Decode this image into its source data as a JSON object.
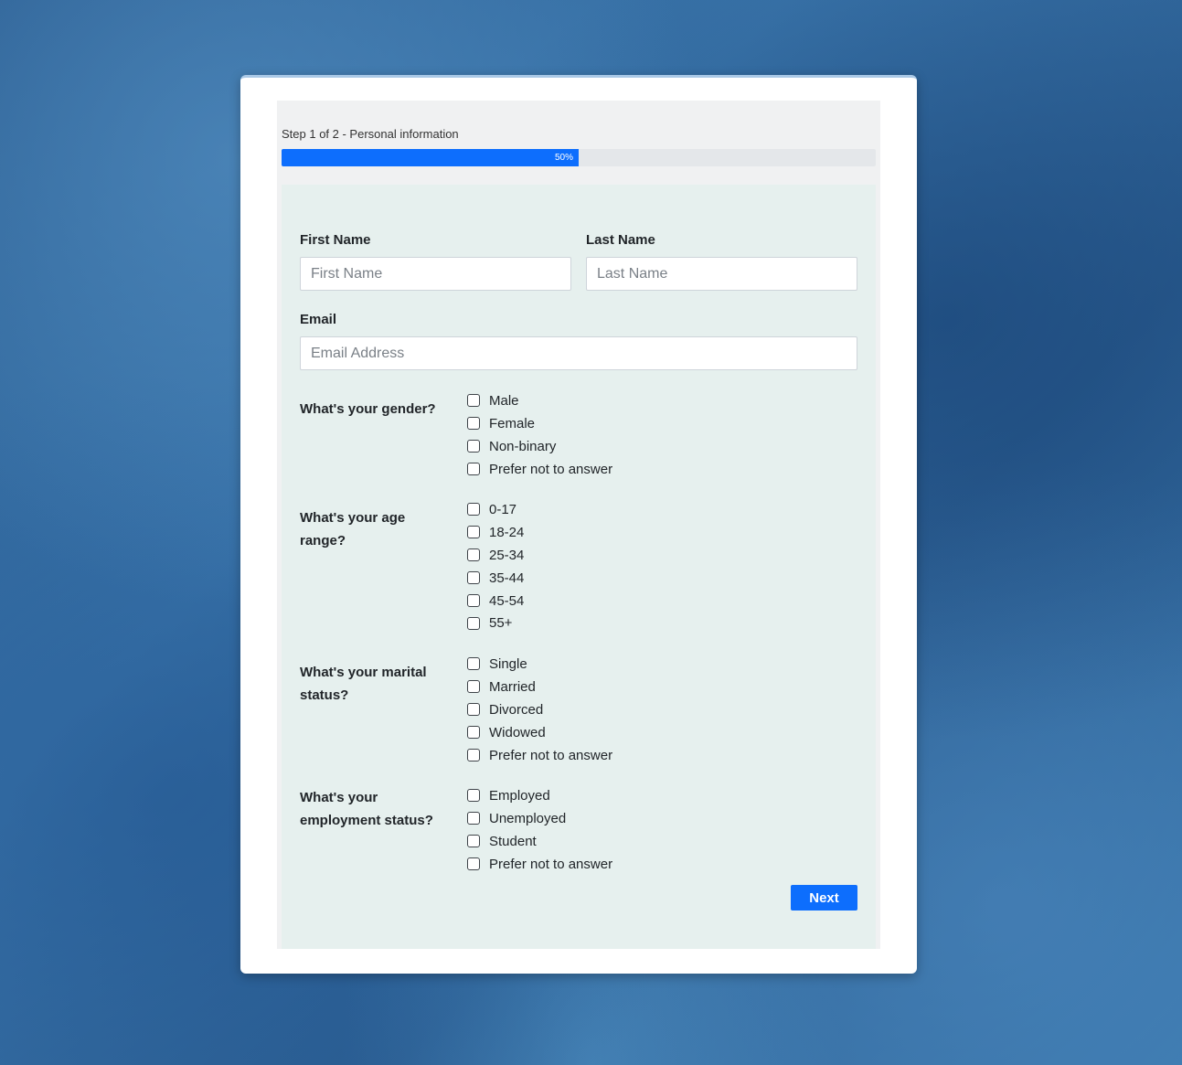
{
  "form": {
    "step_title": "Step 1 of 2 - Personal information",
    "progress": {
      "percent": 50,
      "label": "50%"
    },
    "fields": {
      "first_name": {
        "label": "First Name",
        "placeholder": "First Name",
        "value": ""
      },
      "last_name": {
        "label": "Last Name",
        "placeholder": "Last Name",
        "value": ""
      },
      "email": {
        "label": "Email",
        "placeholder": "Email Address",
        "value": ""
      }
    },
    "questions": {
      "gender": {
        "label": "What's your gender?",
        "options": [
          "Male",
          "Female",
          "Non-binary",
          "Prefer not to answer"
        ]
      },
      "age": {
        "label": "What's your age range?",
        "options": [
          "0-17",
          "18-24",
          "25-34",
          "35-44",
          "45-54",
          "55+"
        ]
      },
      "marital": {
        "label": "What's your marital status?",
        "options": [
          "Single",
          "Married",
          "Divorced",
          "Widowed",
          "Prefer not to answer"
        ]
      },
      "employment": {
        "label": "What's your employment status?",
        "options": [
          "Employed",
          "Unemployed",
          "Student",
          "Prefer not to answer"
        ]
      }
    },
    "next_label": "Next"
  },
  "colors": {
    "accent": "#0d6efd",
    "form_background": "#e6f0ee",
    "shell_background": "#f0f1f2",
    "page_background": "#3a72a8"
  }
}
